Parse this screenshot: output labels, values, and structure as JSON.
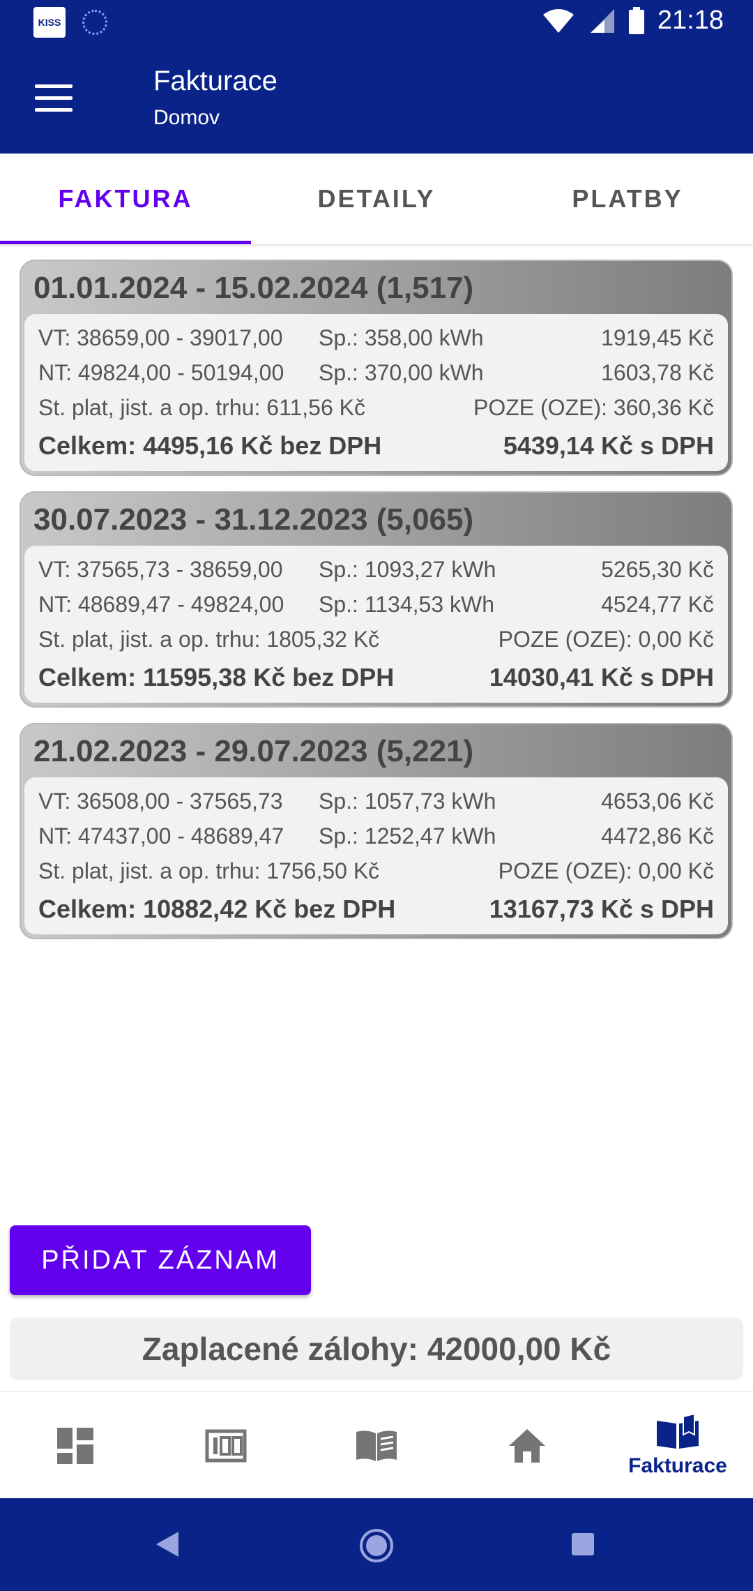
{
  "status_bar": {
    "time": "21:18",
    "app_badge": "KISS"
  },
  "app_bar": {
    "title": "Fakturace",
    "subtitle": "Domov"
  },
  "tabs": [
    {
      "label": "FAKTURA",
      "active": true
    },
    {
      "label": "DETAILY",
      "active": false
    },
    {
      "label": "PLATBY",
      "active": false
    }
  ],
  "cards": [
    {
      "title": "01.01.2024 - 15.02.2024 (1,517)",
      "vt": "VT:  38659,00  -  39017,00",
      "vt_sp": "Sp.: 358,00 kWh",
      "vt_price": "1919,45 Kč",
      "nt": "NT:  49824,00  -  50194,00",
      "nt_sp": "Sp.: 370,00 kWh",
      "nt_price": "1603,78 Kč",
      "fixed": "St. plat, jist. a op. trhu: 611,56 Kč",
      "poze": "POZE (OZE): 360,36 Kč",
      "total": "Celkem: 4495,16 Kč bez DPH",
      "total_vat": "5439,14 Kč s DPH"
    },
    {
      "title": "30.07.2023 - 31.12.2023 (5,065)",
      "vt": "VT:  37565,73  -  38659,00",
      "vt_sp": "Sp.: 1093,27 kWh",
      "vt_price": "5265,30 Kč",
      "nt": "NT:  48689,47  -  49824,00",
      "nt_sp": "Sp.: 1134,53 kWh",
      "nt_price": "4524,77 Kč",
      "fixed": "St. plat, jist. a op. trhu: 1805,32 Kč",
      "poze": "POZE (OZE): 0,00 Kč",
      "total": "Celkem: 11595,38 Kč bez DPH",
      "total_vat": "14030,41 Kč s DPH"
    },
    {
      "title": "21.02.2023 - 29.07.2023 (5,221)",
      "vt": "VT:  36508,00  -  37565,73",
      "vt_sp": "Sp.: 1057,73 kWh",
      "vt_price": "4653,06 Kč",
      "nt": "NT:  47437,00  -  48689,47",
      "nt_sp": "Sp.: 1252,47 kWh",
      "nt_price": "4472,86 Kč",
      "fixed": "St. plat, jist. a op. trhu: 1756,50 Kč",
      "poze": "POZE (OZE): 0,00 Kč",
      "total": "Celkem: 10882,42 Kč bez DPH",
      "total_vat": "13167,73 Kč s DPH"
    }
  ],
  "add_button": "PŘIDAT ZÁZNAM",
  "paid_deposits": "Zaplacené zálohy: 42000,00 Kč",
  "bottom_nav": [
    {
      "icon": "dashboard-icon",
      "label": ""
    },
    {
      "icon": "meter-icon",
      "label": ""
    },
    {
      "icon": "document-icon",
      "label": ""
    },
    {
      "icon": "home-icon",
      "label": ""
    },
    {
      "icon": "book-icon",
      "label": "Fakturace",
      "active": true
    }
  ],
  "colors": {
    "primary": "#0a2389",
    "accent": "#6200ee"
  }
}
